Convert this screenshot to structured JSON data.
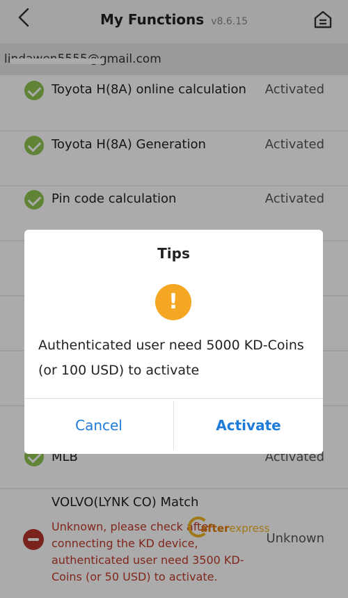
{
  "header": {
    "title": "My Functions",
    "version": "v8.6.15"
  },
  "account": {
    "email": "lindawen5555@gmail.com"
  },
  "functions": [
    {
      "name": "Toyota H(8A) online calculation",
      "status": "Activated"
    },
    {
      "name": "Toyota H(8A) Generation",
      "status": "Activated"
    },
    {
      "name": "Pin code calculation",
      "status": "Activated"
    },
    {
      "name": "MLB",
      "status": "Activated"
    },
    {
      "name": "VOLVO(LYNK CO) Match",
      "status": "Unknown",
      "note": "Unknown, please check after connecting the KD device, authenticated user need 3500 KD-Coins (or 50 USD) to activate."
    }
  ],
  "dialog": {
    "title": "Tips",
    "icon": "warning-icon",
    "message": "Authenticated user need 5000 KD-Coins (or 100 USD) to activate",
    "cancel_label": "Cancel",
    "activate_label": "Activate"
  },
  "watermark": {
    "part1": "after",
    "part2": "express"
  },
  "colors": {
    "accent": "#1f7bd8",
    "check_green": "#8fc34f",
    "error_red": "#c0392b",
    "warning_orange": "#f5a623"
  }
}
